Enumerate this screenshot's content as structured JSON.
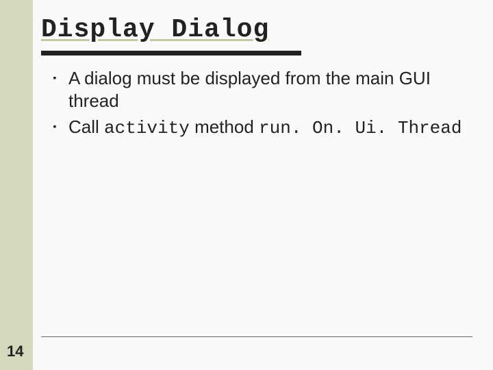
{
  "title": "Display Dialog",
  "bullets": [
    {
      "parts": [
        {
          "text": "A dialog must be displayed from the main GUI thread",
          "mono": false
        }
      ]
    },
    {
      "parts": [
        {
          "text": "Call ",
          "mono": false
        },
        {
          "text": "activity",
          "mono": true
        },
        {
          "text": " method ",
          "mono": false
        },
        {
          "text": "run. On. Ui. Thread",
          "mono": true
        }
      ]
    }
  ],
  "page_number": "14"
}
